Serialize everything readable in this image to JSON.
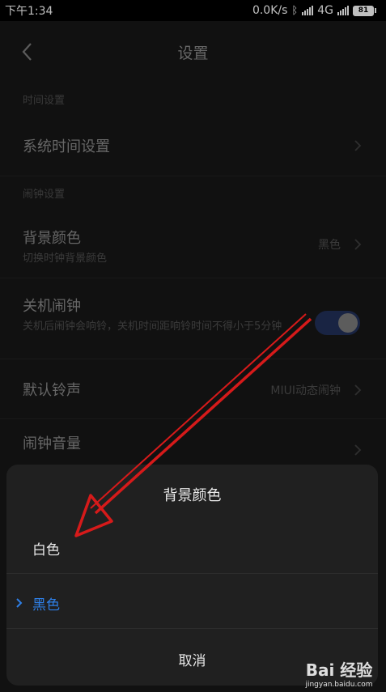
{
  "status_bar": {
    "time": "下午1:34",
    "network_speed": "0.0K/s",
    "network_type": "4G",
    "battery": "81"
  },
  "header": {
    "title": "设置"
  },
  "sections": [
    {
      "label": "时间设置"
    },
    {
      "label": "闹钟设置"
    }
  ],
  "rows": {
    "system_time": {
      "title": "系统时间设置"
    },
    "bg_color": {
      "title": "背景颜色",
      "subtitle": "切换时钟背景颜色",
      "value": "黑色"
    },
    "shutdown_alarm": {
      "title": "关机闹钟",
      "subtitle": "关机后闹钟会响铃，关机时间距响铃时间不得小于5分钟",
      "enabled": true
    },
    "default_ringtone": {
      "title": "默认铃声",
      "value": "MIUI动态闹钟"
    },
    "alarm_volume": {
      "title": "闹钟音量"
    }
  },
  "dialog": {
    "title": "背景颜色",
    "options": [
      {
        "label": "白色",
        "selected": false
      },
      {
        "label": "黑色",
        "selected": true
      }
    ],
    "cancel_label": "取消"
  },
  "watermark": {
    "logo": "Bai 经验",
    "url": "jingyan.baidu.com"
  },
  "colors": {
    "accent": "#2e7fe6",
    "annotation_arrow": "#d61a1a",
    "toggle_on": "#22305a"
  },
  "icons": [
    "back-icon",
    "chevron-right-icon",
    "checkmark-icon",
    "bluetooth-icon",
    "signal-icon",
    "battery-icon"
  ]
}
